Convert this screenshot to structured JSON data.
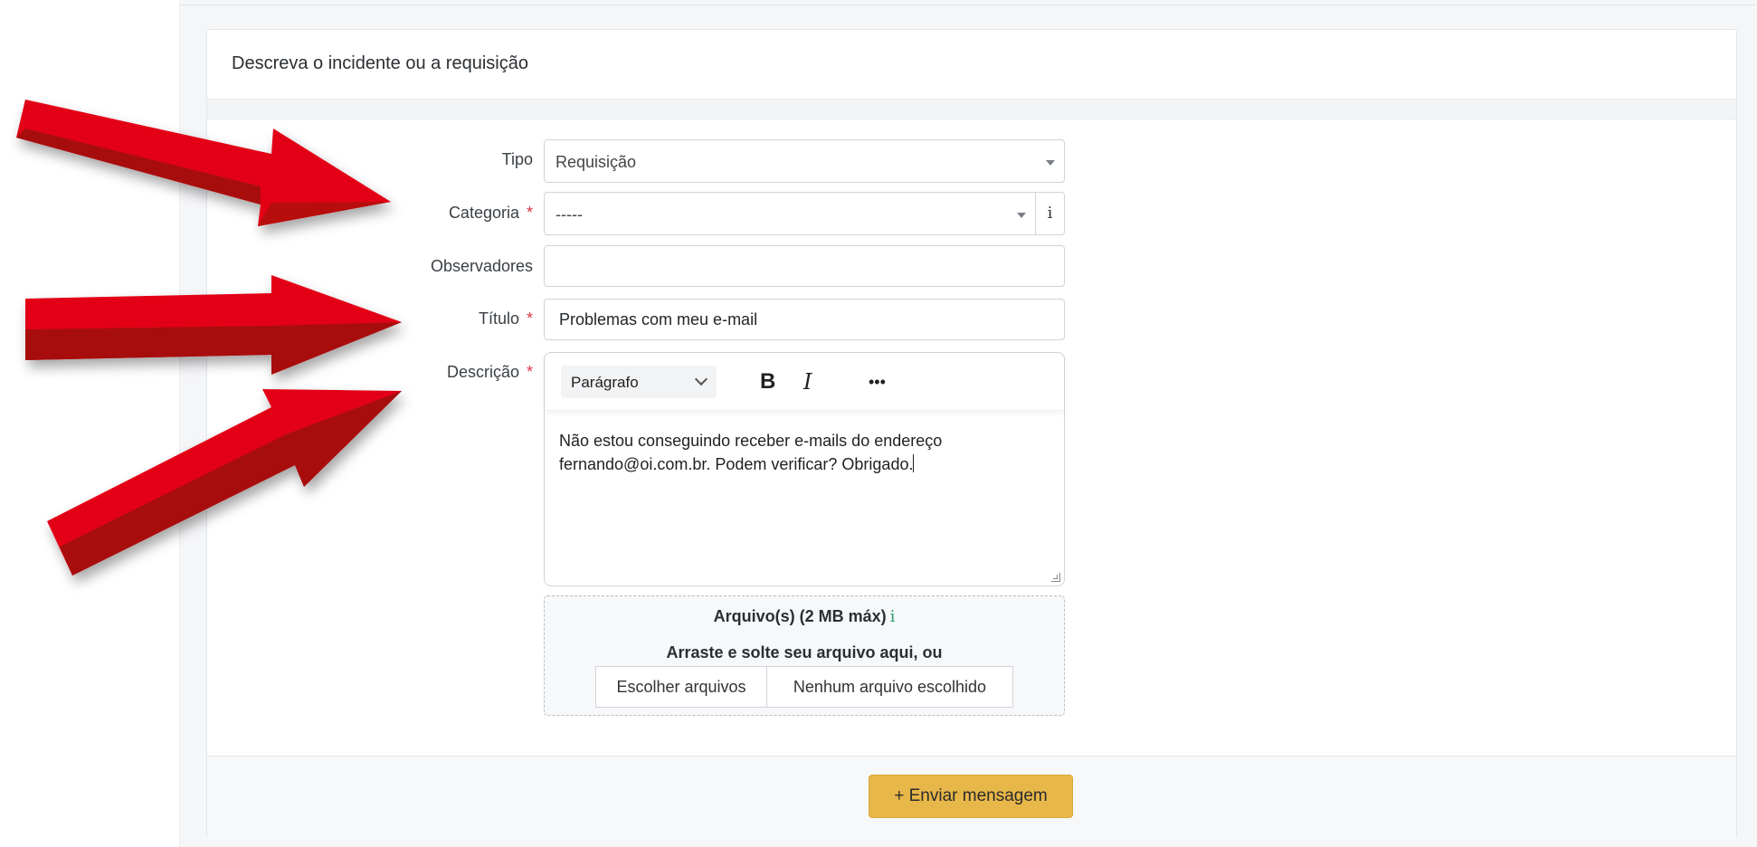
{
  "card": {
    "title": "Descreva o incidente ou a requisição"
  },
  "form": {
    "tipo": {
      "label": "Tipo",
      "value": "Requisição"
    },
    "categoria": {
      "label": "Categoria",
      "required_mark": "*",
      "value": "-----",
      "info": "i"
    },
    "observadores": {
      "label": "Observadores",
      "value": ""
    },
    "titulo": {
      "label": "Título",
      "required_mark": "*",
      "value": "Problemas com meu e-mail"
    },
    "descricao": {
      "label": "Descrição",
      "required_mark": "*",
      "format": "Parágrafo",
      "bold": "B",
      "italic": "I",
      "more": "•••",
      "text": "Não estou conseguindo receber e-mails do endereço fernando@oi.com.br. Podem verificar? Obrigado."
    },
    "attachments": {
      "title": "Arquivo(s) (2 MB máx)",
      "info": "i",
      "drop_text": "Arraste e solte seu arquivo aqui, ou",
      "choose_button": "Escolher arquivos",
      "status": "Nenhum arquivo escolhido"
    }
  },
  "footer": {
    "submit_label": "+ Enviar mensagem"
  },
  "colors": {
    "arrow": "#e30613",
    "arrow_shade": "#a8100f",
    "submit": "#e8b74a",
    "required": "#dc3545"
  },
  "annotations": {
    "arrow_count": 3
  }
}
